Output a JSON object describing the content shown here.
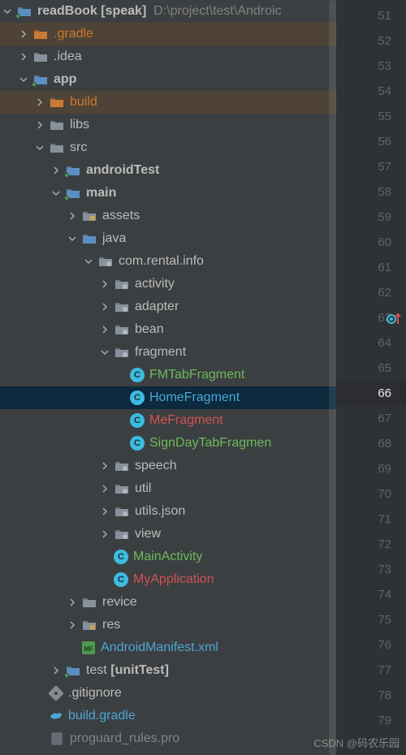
{
  "project": {
    "name": "readBook",
    "scope": "[speak]",
    "path": "D:\\project\\test\\Androic"
  },
  "tree": {
    "gradle": ".gradle",
    "idea": ".idea",
    "app": "app",
    "build": "build",
    "libs": "libs",
    "src": "src",
    "androidTest": "androidTest",
    "main": "main",
    "assets": "assets",
    "java": "java",
    "pkg": "com.rental.info",
    "activity": "activity",
    "adapter": "adapter",
    "bean": "bean",
    "fragment": "fragment",
    "fm_tab": "FMTabFragment",
    "home": "HomeFragment",
    "me": "MeFragment",
    "signday": "SignDayTabFragmen",
    "speech": "speech",
    "util": "util",
    "utilsjson": "utils.json",
    "view": "view",
    "mainact": "MainActivity",
    "myapp": "MyApplication",
    "revice": "revice",
    "res": "res",
    "manifest": "AndroidManifest.xml",
    "test": "test",
    "unittest": "[unitTest]",
    "gitignore": ".gitignore",
    "buildgradle": "build.gradle",
    "proguard": "proguard_rules.pro"
  },
  "gutter": {
    "start": 51,
    "end": 79,
    "icon_line": 63
  },
  "watermark": "CSDN @码农乐园"
}
